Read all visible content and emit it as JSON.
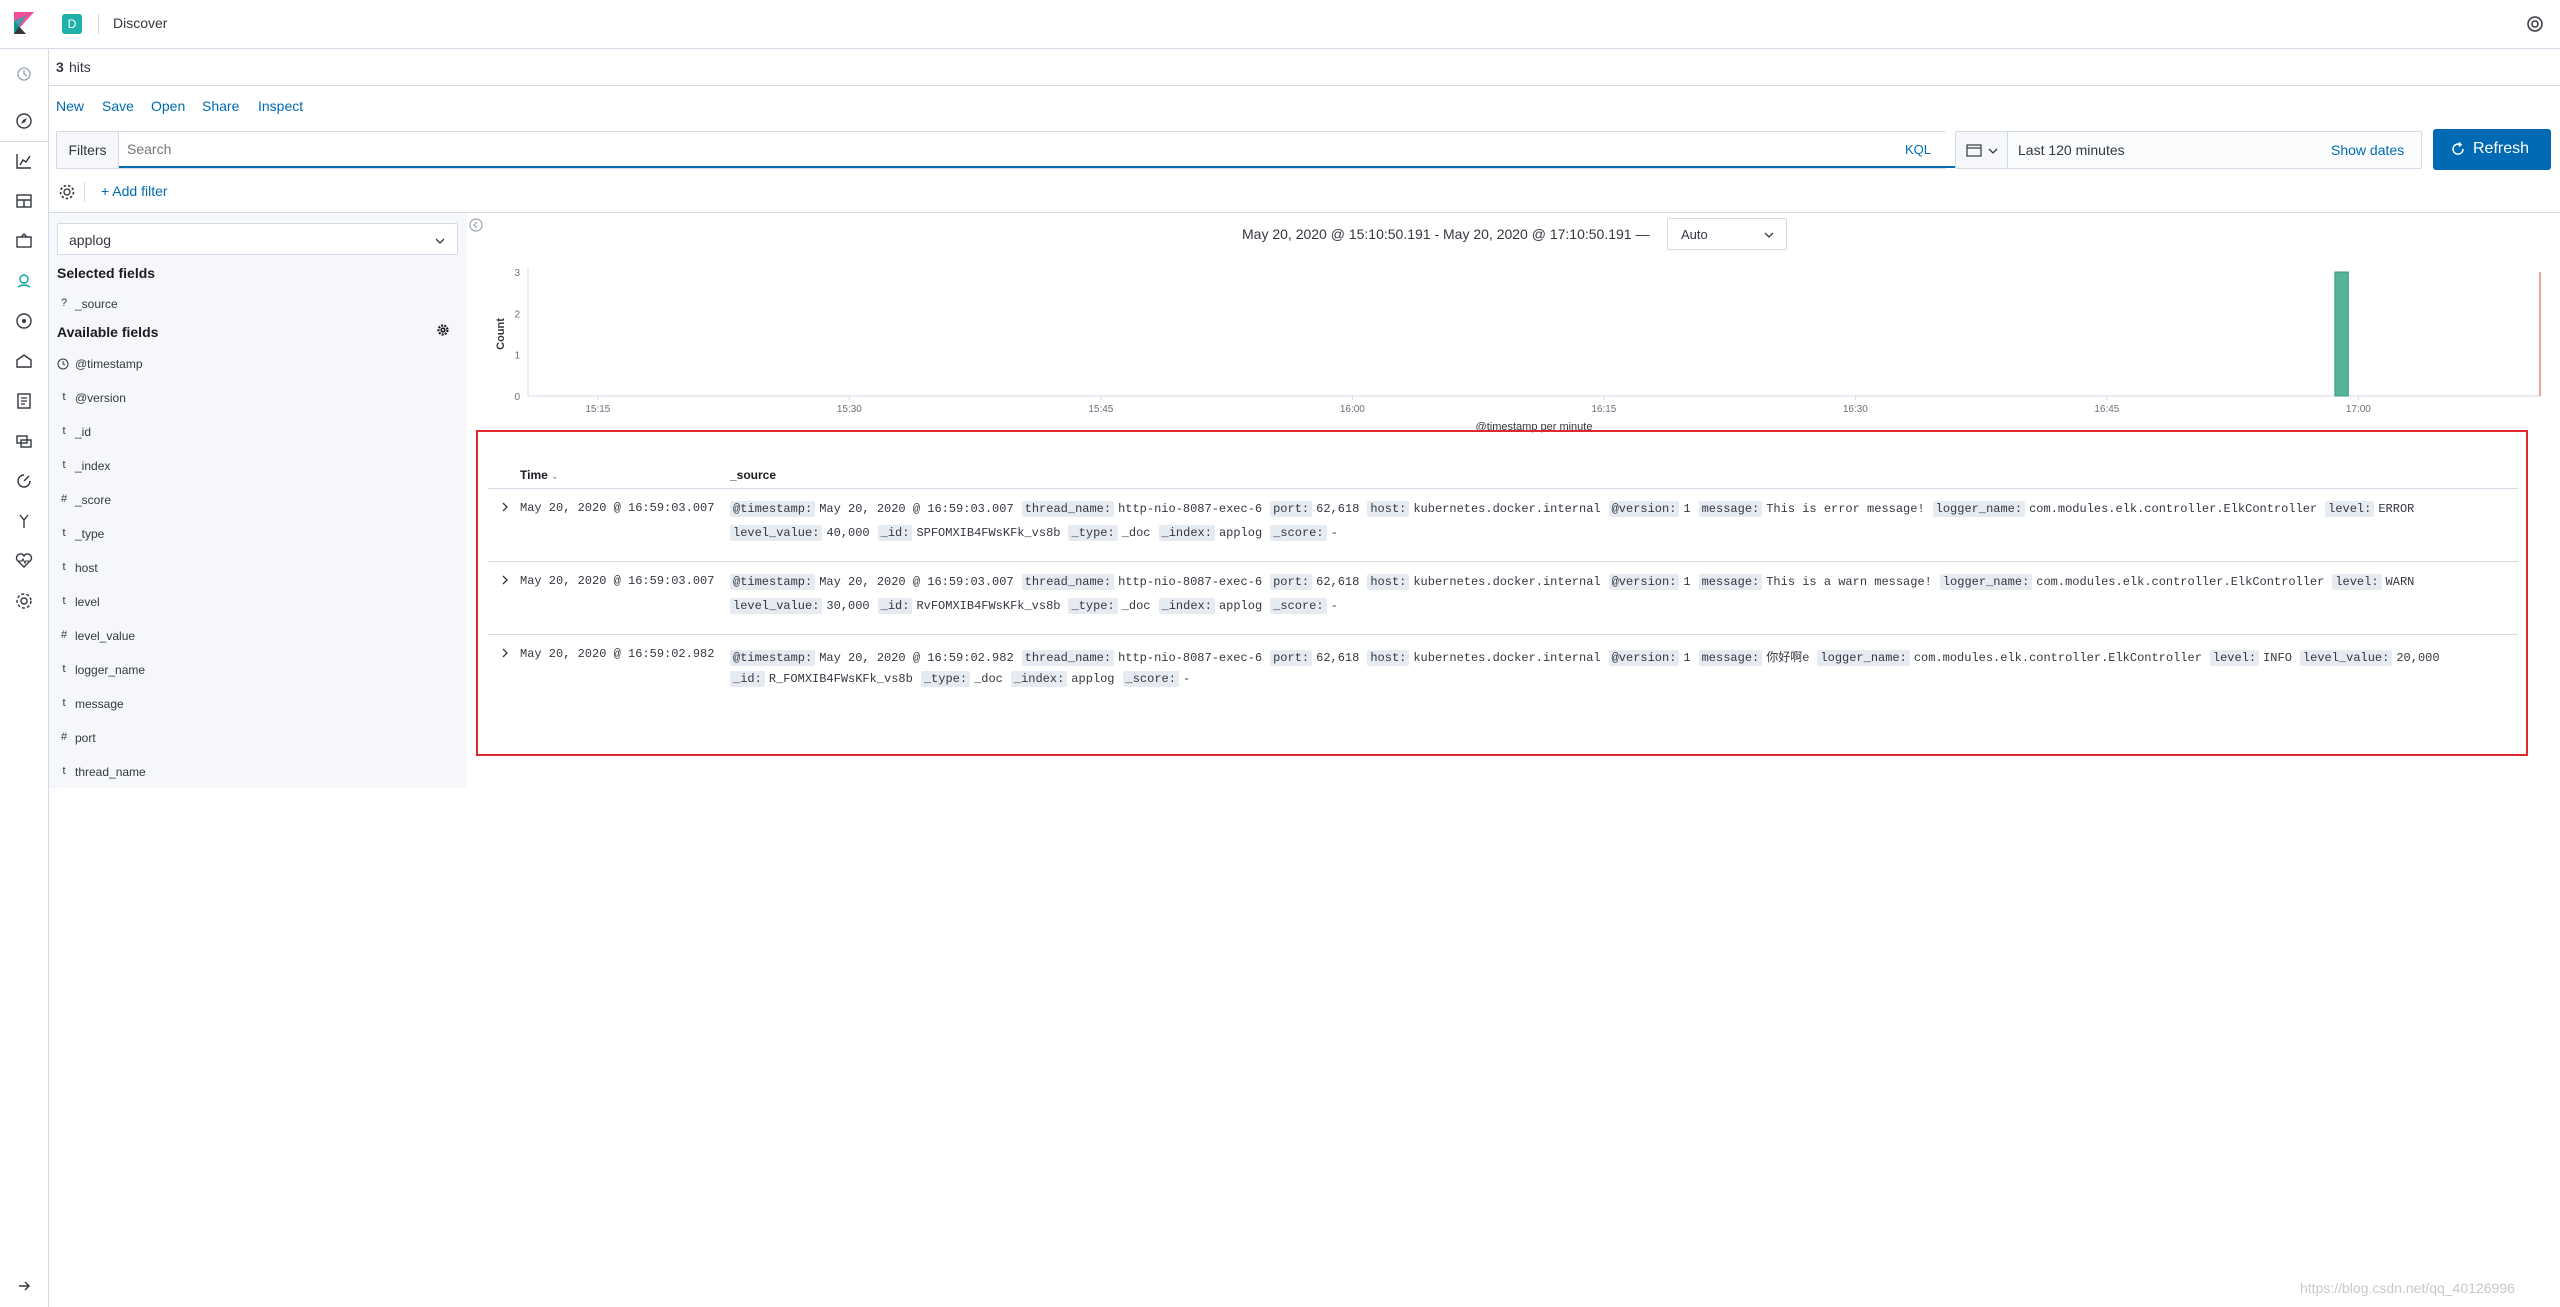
{
  "header": {
    "space_initial": "D",
    "app_title": "Discover"
  },
  "nav": {
    "icons": [
      "recent-icon",
      "discover-icon",
      "visualize-icon",
      "dashboard-icon",
      "canvas-icon",
      "maps-icon",
      "ml-icon",
      "infrastructure-icon",
      "logs-icon",
      "apm-icon",
      "uptime-icon",
      "dev-tools-icon",
      "monitoring-icon",
      "management-icon",
      "collapse-nav-icon"
    ]
  },
  "hits": {
    "count": "3",
    "label": "hits"
  },
  "top_menu": {
    "new": "New",
    "save": "Save",
    "open": "Open",
    "share": "Share",
    "inspect": "Inspect"
  },
  "query": {
    "filters_label": "Filters",
    "placeholder": "Search",
    "language": "KQL"
  },
  "date_picker": {
    "range": "Last 120 minutes",
    "show_dates": "Show dates"
  },
  "refresh_label": "Refresh",
  "add_filter": "+ Add filter",
  "sidebar": {
    "index_pattern": "applog",
    "selected_heading": "Selected fields",
    "selected_fields": [
      {
        "type": "?",
        "name": "_source"
      }
    ],
    "available_heading": "Available fields",
    "available_fields": [
      {
        "type": "clock",
        "name": "@timestamp"
      },
      {
        "type": "t",
        "name": "@version"
      },
      {
        "type": "t",
        "name": "_id"
      },
      {
        "type": "t",
        "name": "_index"
      },
      {
        "type": "#",
        "name": "_score"
      },
      {
        "type": "t",
        "name": "_type"
      },
      {
        "type": "t",
        "name": "host"
      },
      {
        "type": "t",
        "name": "level"
      },
      {
        "type": "#",
        "name": "level_value"
      },
      {
        "type": "t",
        "name": "logger_name"
      },
      {
        "type": "t",
        "name": "message"
      },
      {
        "type": "#",
        "name": "port"
      },
      {
        "type": "t",
        "name": "thread_name"
      }
    ]
  },
  "chart_header": {
    "range": "May 20, 2020 @ 15:10:50.191 - May 20, 2020 @ 17:10:50.191 —",
    "interval": "Auto"
  },
  "chart_data": {
    "type": "bar",
    "ylabel": "Count",
    "xlabel": "@timestamp per minute",
    "x_ticks": [
      "15:15",
      "15:30",
      "15:45",
      "16:00",
      "16:15",
      "16:30",
      "16:45",
      "17:00"
    ],
    "x_range": [
      "15:10:50",
      "17:10:50"
    ],
    "y_ticks": [
      0,
      1,
      2,
      3
    ],
    "ylim": [
      0,
      3
    ],
    "bar_color": "#54b399",
    "series": [
      {
        "x": [
          "16:59"
        ],
        "values": [
          3
        ]
      }
    ],
    "now_marker": "17:10:50"
  },
  "table": {
    "time_header": "Time",
    "source_header": "_source",
    "rows": [
      {
        "time": "May 20, 2020 @ 16:59:03.007",
        "lines": [
          [
            [
              "@timestamp:",
              "May 20, 2020 @ 16:59:03.007"
            ],
            [
              "thread_name:",
              "http-nio-8087-exec-6"
            ],
            [
              "port:",
              "62,618"
            ],
            [
              "host:",
              "kubernetes.docker.internal"
            ],
            [
              "@version:",
              "1"
            ],
            [
              "message:",
              "This is error message!"
            ],
            [
              "logger_name:",
              "com.modules.elk.controller.ElkController"
            ],
            [
              "level:",
              "ERROR"
            ]
          ],
          [
            [
              "level_value:",
              "40,000"
            ],
            [
              "_id:",
              "SPFOMXIB4FWsKFk_vs8b"
            ],
            [
              "_type:",
              "_doc"
            ],
            [
              "_index:",
              "applog"
            ],
            [
              "_score:",
              "-"
            ]
          ]
        ]
      },
      {
        "time": "May 20, 2020 @ 16:59:03.007",
        "lines": [
          [
            [
              "@timestamp:",
              "May 20, 2020 @ 16:59:03.007"
            ],
            [
              "thread_name:",
              "http-nio-8087-exec-6"
            ],
            [
              "port:",
              "62,618"
            ],
            [
              "host:",
              "kubernetes.docker.internal"
            ],
            [
              "@version:",
              "1"
            ],
            [
              "message:",
              "This is a warn message!"
            ],
            [
              "logger_name:",
              "com.modules.elk.controller.ElkController"
            ],
            [
              "level:",
              "WARN"
            ]
          ],
          [
            [
              "level_value:",
              "30,000"
            ],
            [
              "_id:",
              "RvFOMXIB4FWsKFk_vs8b"
            ],
            [
              "_type:",
              "_doc"
            ],
            [
              "_index:",
              "applog"
            ],
            [
              "_score:",
              "-"
            ]
          ]
        ]
      },
      {
        "time": "May 20, 2020 @ 16:59:02.982",
        "lines": [
          [
            [
              "@timestamp:",
              "May 20, 2020 @ 16:59:02.982"
            ],
            [
              "thread_name:",
              "http-nio-8087-exec-6"
            ],
            [
              "port:",
              "62,618"
            ],
            [
              "host:",
              "kubernetes.docker.internal"
            ],
            [
              "@version:",
              "1"
            ],
            [
              "message:",
              "你好啊e"
            ],
            [
              "logger_name:",
              "com.modules.elk.controller.ElkController"
            ],
            [
              "level:",
              "INFO"
            ],
            [
              "level_value:",
              "20,000"
            ]
          ],
          [
            [
              "_id:",
              "R_FOMXIB4FWsKFk_vs8b"
            ],
            [
              "_type:",
              "_doc"
            ],
            [
              "_index:",
              "applog"
            ],
            [
              "_score:",
              "-"
            ]
          ]
        ]
      }
    ]
  },
  "watermark": "https://blog.csdn.net/qq_40126996"
}
